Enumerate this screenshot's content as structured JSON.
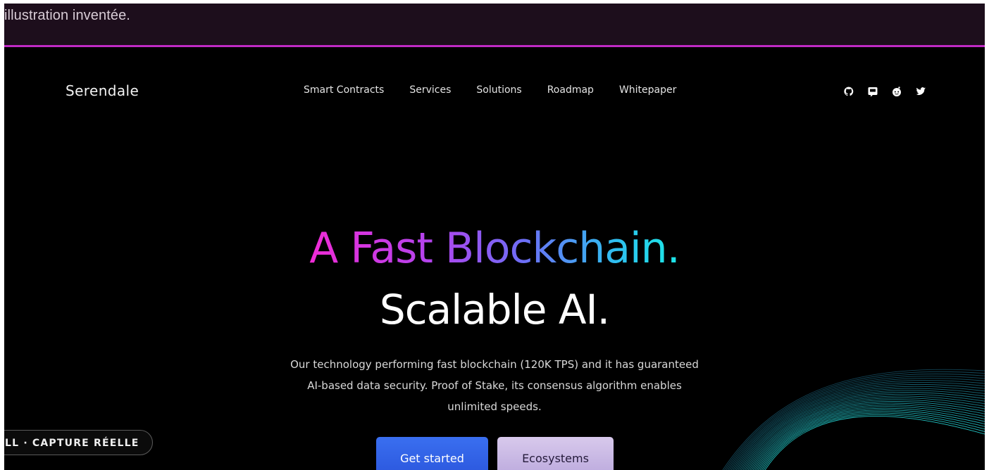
{
  "banner": {
    "text": "illustration inventée."
  },
  "site": {
    "logo": "Serendale",
    "nav": [
      {
        "label": "Smart Contracts"
      },
      {
        "label": "Services"
      },
      {
        "label": "Solutions"
      },
      {
        "label": "Roadmap"
      },
      {
        "label": "Whitepaper"
      }
    ],
    "social_icons": [
      "github-icon",
      "discord-icon",
      "reddit-icon",
      "twitter-icon"
    ],
    "hero": {
      "headline_gradient": "A Fast Blockchain",
      "headline_dot": ".",
      "headline_line2": "Scalable AI.",
      "description_lines": [
        "Our technology performing fast blockchain (120K TPS) and it has guaranteed",
        "AI-based data security. Proof of Stake, its consensus algorithm enables",
        "unlimited speeds."
      ],
      "primary_button": "Get started",
      "secondary_button": "Ecosystems"
    }
  },
  "badge": {
    "text": "LL · CAPTURE RÉELLE"
  },
  "colors": {
    "banner_bg": "#1d0e1c",
    "banner_border": "#c02ac4",
    "gradient_start": "#f02bd6",
    "gradient_end": "#1ee2e8",
    "primary_button": "#2a55dc",
    "secondary_button": "#c4b4e2"
  }
}
